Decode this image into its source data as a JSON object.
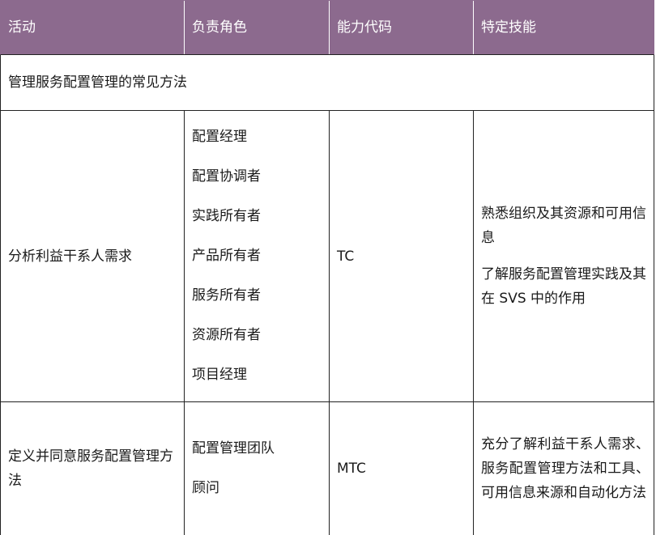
{
  "headers": [
    "活动",
    "负责角色",
    "能力代码",
    "特定技能"
  ],
  "section_title": "管理服务配置管理的常见方法",
  "rows": [
    {
      "activity": "分析利益干系人需求",
      "roles": [
        "配置经理",
        "配置协调者",
        "实践所有者",
        "产品所有者",
        "服务所有者",
        "资源所有者",
        "项目经理"
      ],
      "code": "TC",
      "skills": [
        "熟悉组织及其资源和可用信息",
        "了解服务配置管理实践及其在 SVS 中的作用"
      ]
    },
    {
      "activity": "定义并同意服务配置管理方法",
      "roles": [
        "配置管理团队",
        "顾问"
      ],
      "code": "MTC",
      "skills": [
        "充分了解利益干系人需求、服务配置管理方法和工具、可用信息来源和自动化方法"
      ]
    }
  ]
}
